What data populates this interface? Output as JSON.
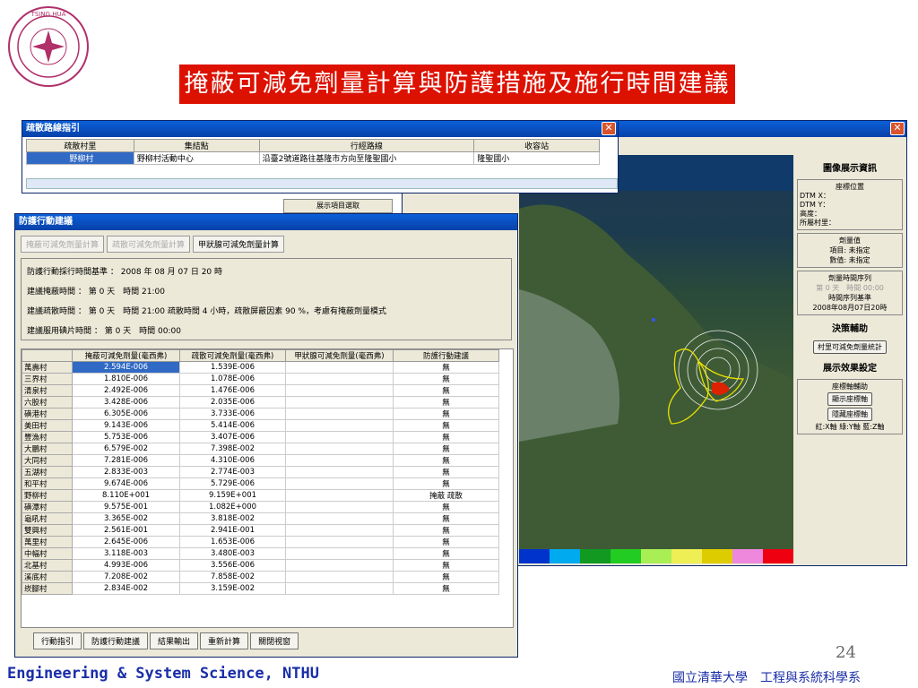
{
  "slide": {
    "title": "掩蔽可減免劑量計算與防護措施及施行時間建議",
    "page_number": "24",
    "footer_left": "Engineering & System Science, NTHU",
    "footer_right": "國立清華大學　工程與系統科學系",
    "logo_text": "NATIONAL TSING HUA UNIVERSITY"
  },
  "colors": {
    "title_bg": "#dd1100",
    "footer": "#1a2ea8",
    "accent": "#0a5fd8"
  },
  "map_window": {
    "info_title": "圖像展示資訊",
    "coord_group_title": "座標位置",
    "coord_lines": [
      "DTM X：",
      "DTM Y：",
      "高度：",
      "所屬村里："
    ],
    "dose_group_title": "劑量值",
    "dose_item": "項目: 未指定",
    "dose_value": "數值: 未指定",
    "dose_series_title": "劑量時間序列",
    "dose_series_time": "第 0 天　時間 00:00",
    "series_base_label": "時間序列基準",
    "series_base_value": "2008年08月07日20時",
    "decision_head": "決策輔助",
    "village_stats_button": "村里可減免劑量統計",
    "display_settings_head": "展示效果設定",
    "coord_aid_label": "座標軸輔助",
    "show_axes_button": "顯示座標軸",
    "hide_axes_button": "隱藏座標軸",
    "axes_legend": "紅:X軸 綠:Y軸 藍:Z軸",
    "colorbar": [
      "#0033cc",
      "#00aaee",
      "#119922",
      "#22cc22",
      "#aaee55",
      "#eeee55",
      "#ddcc00",
      "#ee88dd",
      "#ee0011"
    ]
  },
  "display_items_label": "展示項目選取",
  "evac_window": {
    "title": "疏散路線指引",
    "headers": [
      "疏散村里",
      "集結點",
      "行經路線",
      "收容站"
    ],
    "row": [
      "野柳村",
      "野柳村活動中心",
      "沿臺2號道路往基隆市方向至隆聖國小",
      "隆聖國小"
    ]
  },
  "protect_window": {
    "title": "防護行動建議",
    "tabs": [
      "掩蔽可減免劑量計算",
      "疏散可減免劑量計算",
      "甲狀腺可減免劑量計算"
    ],
    "info_lines": [
      "防護行動採行時間基準 ： 2008 年 08 月 07 日 20 時",
      "建議掩蔽時間 ： 第 0 天　時間 21:00",
      "建議疏散時間 ： 第 0 天　時間 21:00 疏散時間 4 小時，疏散屏蔽因素 90 %，考慮有掩蔽劑量模式",
      "建議服用碘片時間 ： 第 0 天　時間 00:00"
    ],
    "headers": [
      "",
      "掩蔽可減免劑量(毫西弗)",
      "疏散可減免劑量(毫西弗)",
      "甲狀腺可減免劑量(毫西弗)",
      "防護行動建議"
    ],
    "rows": [
      [
        "萬壽村",
        "2.594E-006",
        "1.539E-006",
        "",
        "無"
      ],
      [
        "三界村",
        "1.810E-006",
        "1.078E-006",
        "",
        "無"
      ],
      [
        "清泉村",
        "2.492E-006",
        "1.476E-006",
        "",
        "無"
      ],
      [
        "六股村",
        "3.428E-006",
        "2.035E-006",
        "",
        "無"
      ],
      [
        "磺港村",
        "6.305E-006",
        "3.733E-006",
        "",
        "無"
      ],
      [
        "美田村",
        "9.143E-006",
        "5.414E-006",
        "",
        "無"
      ],
      [
        "豐漁村",
        "5.753E-006",
        "3.407E-006",
        "",
        "無"
      ],
      [
        "大鵬村",
        "6.579E-002",
        "7.398E-002",
        "",
        "無"
      ],
      [
        "大同村",
        "7.281E-006",
        "4.310E-006",
        "",
        "無"
      ],
      [
        "五湖村",
        "2.833E-003",
        "2.774E-003",
        "",
        "無"
      ],
      [
        "和平村",
        "9.674E-006",
        "5.729E-006",
        "",
        "無"
      ],
      [
        "野柳村",
        "8.110E+001",
        "9.159E+001",
        "",
        "掩蔽 疏散"
      ],
      [
        "磺潭村",
        "9.575E-001",
        "1.082E+000",
        "",
        "無"
      ],
      [
        "龜吼村",
        "3.365E-002",
        "3.818E-002",
        "",
        "無"
      ],
      [
        "雙興村",
        "2.561E-001",
        "2.941E-001",
        "",
        "無"
      ],
      [
        "萬里村",
        "2.645E-006",
        "1.653E-006",
        "",
        "無"
      ],
      [
        "中幅村",
        "3.118E-003",
        "3.480E-003",
        "",
        "無"
      ],
      [
        "北基村",
        "4.993E-006",
        "3.556E-006",
        "",
        "無"
      ],
      [
        "溪底村",
        "7.208E-002",
        "7.858E-002",
        "",
        "無"
      ],
      [
        "崁腳村",
        "2.834E-002",
        "3.159E-002",
        "",
        "無"
      ]
    ],
    "bottom_buttons": [
      "行動指引",
      "防護行動建議",
      "結果輸出",
      "重新計算",
      "關閉視窗"
    ]
  }
}
